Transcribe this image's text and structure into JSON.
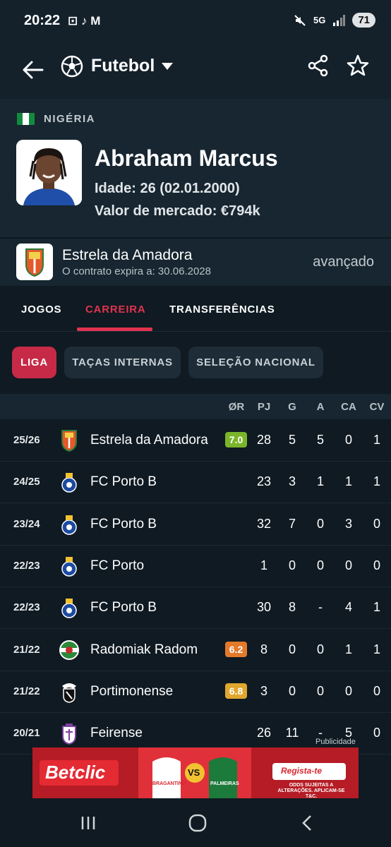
{
  "status": {
    "time": "20:22",
    "notif_icons": "⊡ ♪ M",
    "network": "5G",
    "battery": "71"
  },
  "app_bar": {
    "title": "Futebol"
  },
  "player": {
    "country": "NIGÉRIA",
    "name": "Abraham Marcus",
    "age_line": "Idade: 26 (02.01.2000)",
    "value_line": "Valor de mercado: €794k"
  },
  "club": {
    "name": "Estrela da Amadora",
    "contract": "O contrato expira a: 30.06.2028",
    "position": "avançado"
  },
  "tabs": [
    {
      "label": "JOGOS",
      "active": false
    },
    {
      "label": "CARREIRA",
      "active": true
    },
    {
      "label": "TRANSFERÊNCIAS",
      "active": false
    }
  ],
  "chips": [
    {
      "label": "LIGA",
      "active": true
    },
    {
      "label": "TAÇAS INTERNAS",
      "active": false
    },
    {
      "label": "SELEÇÃO NACIONAL",
      "active": false
    }
  ],
  "table": {
    "headers": [
      "ØR",
      "PJ",
      "G",
      "A",
      "CA",
      "CV"
    ],
    "rows": [
      {
        "season": "25/26",
        "team": "Estrela da Amadora",
        "rating": "7.0",
        "rating_color": "#7bb52a",
        "pj": "28",
        "g": "5",
        "a": "5",
        "ca": "0",
        "cv": "1",
        "logo": "estrela"
      },
      {
        "season": "24/25",
        "team": "FC Porto B",
        "rating": "",
        "rating_color": "",
        "pj": "23",
        "g": "3",
        "a": "1",
        "ca": "1",
        "cv": "1",
        "logo": "porto"
      },
      {
        "season": "23/24",
        "team": "FC Porto B",
        "rating": "",
        "rating_color": "",
        "pj": "32",
        "g": "7",
        "a": "0",
        "ca": "3",
        "cv": "0",
        "logo": "porto"
      },
      {
        "season": "22/23",
        "team": "FC Porto",
        "rating": "",
        "rating_color": "",
        "pj": "1",
        "g": "0",
        "a": "0",
        "ca": "0",
        "cv": "0",
        "logo": "porto"
      },
      {
        "season": "22/23",
        "team": "FC Porto B",
        "rating": "",
        "rating_color": "",
        "pj": "30",
        "g": "8",
        "a": "-",
        "ca": "4",
        "cv": "1",
        "logo": "porto"
      },
      {
        "season": "21/22",
        "team": "Radomiak Radom",
        "rating": "6.2",
        "rating_color": "#e37a2a",
        "pj": "8",
        "g": "0",
        "a": "0",
        "ca": "1",
        "cv": "1",
        "logo": "radomiak"
      },
      {
        "season": "21/22",
        "team": "Portimonense",
        "rating": "6.8",
        "rating_color": "#e0a72e",
        "pj": "3",
        "g": "0",
        "a": "0",
        "ca": "0",
        "cv": "0",
        "logo": "portimonense"
      },
      {
        "season": "20/21",
        "team": "Feirense",
        "rating": "",
        "rating_color": "",
        "pj": "26",
        "g": "11",
        "a": "-",
        "ca": "5",
        "cv": "0",
        "logo": "feirense"
      }
    ]
  },
  "ad": {
    "label": "Publicidade",
    "brand": "Betclic",
    "vs": "VS",
    "cta": "Regista-te",
    "fine_print": "ODDS SUJEITAS A ALTERAÇÕES. APLICAM-SE T&C.",
    "team_left": "BRAGANTINO",
    "team_right": "PALMEIRAS"
  }
}
